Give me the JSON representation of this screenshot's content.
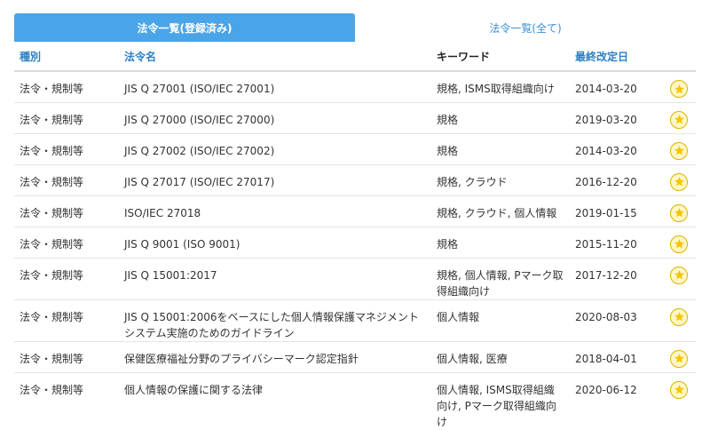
{
  "tabs": [
    {
      "label": "法令一覧(登録済み)",
      "active": true
    },
    {
      "label": "法令一覧(全て)",
      "active": false
    }
  ],
  "columns": [
    "種別",
    "法令名",
    "キーワード",
    "最終改定日",
    ""
  ],
  "rows": [
    {
      "type": "法令・規制等",
      "name": "JIS Q 27001 (ISO/IEC 27001)",
      "keywords": "規格, ISMS取得組織向け",
      "date": "2014-03-20",
      "starred": true
    },
    {
      "type": "法令・規制等",
      "name": "JIS Q 27000 (ISO/IEC 27000)",
      "keywords": "規格",
      "date": "2019-03-20",
      "starred": true
    },
    {
      "type": "法令・規制等",
      "name": "JIS Q 27002 (ISO/IEC 27002)",
      "keywords": "規格",
      "date": "2014-03-20",
      "starred": true
    },
    {
      "type": "法令・規制等",
      "name": "JIS Q 27017 (ISO/IEC 27017)",
      "keywords": "規格, クラウド",
      "date": "2016-12-20",
      "starred": true
    },
    {
      "type": "法令・規制等",
      "name": "ISO/IEC 27018",
      "keywords": "規格, クラウド, 個人情報",
      "date": "2019-01-15",
      "starred": true
    },
    {
      "type": "法令・規制等",
      "name": "JIS Q 9001 (ISO 9001)",
      "keywords": "規格",
      "date": "2015-11-20",
      "starred": true
    },
    {
      "type": "法令・規制等",
      "name": "JIS Q 15001:2017",
      "keywords": "規格, 個人情報, Pマーク取得組織向け",
      "date": "2017-12-20",
      "starred": true
    },
    {
      "type": "法令・規制等",
      "name": "JIS Q 15001:2006をベースにした個人情報保護マネジメントシステム実施のためのガイドライン",
      "keywords": "個人情報",
      "date": "2020-08-03",
      "starred": true
    },
    {
      "type": "法令・規制等",
      "name": "保健医療福祉分野のプライバシーマーク認定指針",
      "keywords": "個人情報, 医療",
      "date": "2018-04-01",
      "starred": true
    },
    {
      "type": "法令・規制等",
      "name": "個人情報の保護に関する法律",
      "keywords": "個人情報, ISMS取得組織向け, Pマーク取得組織向け",
      "date": "2020-06-12",
      "starred": true
    }
  ],
  "colors": {
    "accent": "#4aa4e8",
    "link": "#2d7fc4",
    "star": "#f5c400"
  }
}
